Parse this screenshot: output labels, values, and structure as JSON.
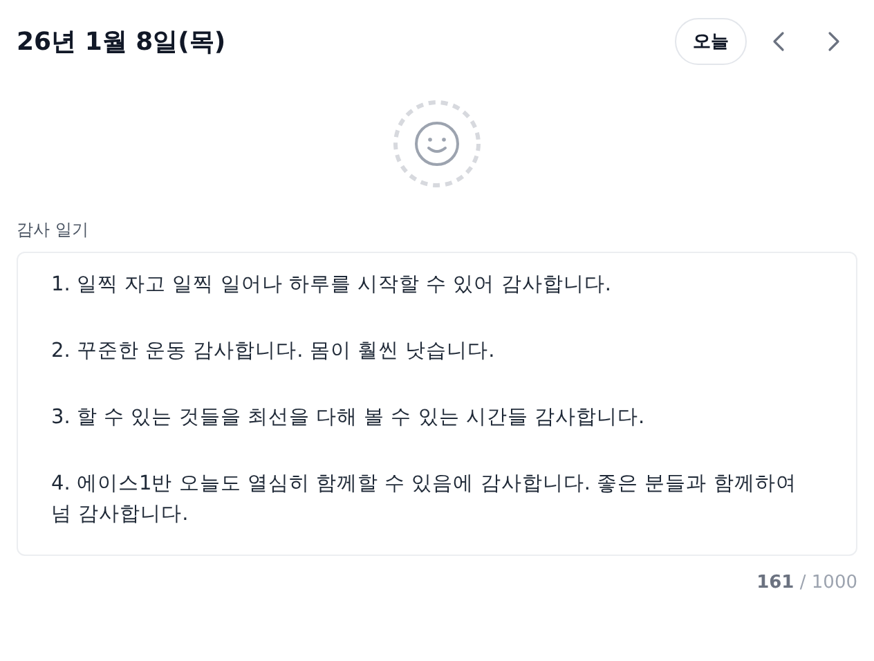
{
  "header": {
    "date": "26년 1월 8일(목)",
    "today_button": "오늘"
  },
  "diary": {
    "label": "감사 일기",
    "entries": [
      "1. 일찍 자고 일찍 일어나 하루를 시작할 수 있어 감사합니다.",
      "2. 꾸준한 운동 감사합니다. 몸이 훨씬 낫습니다.",
      "3. 할 수 있는 것들을 최선을 다해 볼 수 있는 시간들 감사합니다.",
      "4. 에이스1반 오늘도 열심히 함께할 수 있음에 감사합니다. 좋은 분들과 함께하여 넘 감사합니다."
    ],
    "count": "161",
    "separator": "/",
    "max": "1000"
  }
}
